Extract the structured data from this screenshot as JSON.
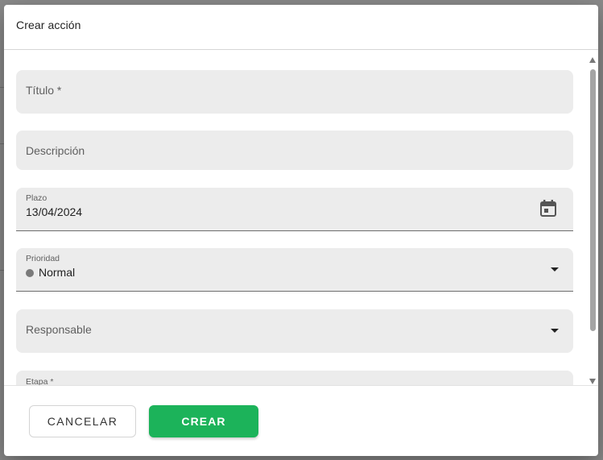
{
  "dialog": {
    "title": "Crear acción",
    "fields": {
      "titulo": {
        "placeholder": "Título *"
      },
      "descripcion": {
        "placeholder": "Descripción"
      },
      "plazo": {
        "label": "Plazo",
        "value": "13/04/2024",
        "icon": "calendar-icon"
      },
      "prioridad": {
        "label": "Prioridad",
        "value": "Normal",
        "dot_color": "#7a7a7a",
        "icon": "dropdown-arrow-icon"
      },
      "responsable": {
        "placeholder": "Responsable",
        "icon": "dropdown-arrow-icon"
      },
      "etapa": {
        "label": "Etapa *"
      }
    },
    "buttons": {
      "cancel": "CANCELAR",
      "create": "CREAR"
    }
  },
  "colors": {
    "accent": "#1cb35a",
    "field_bg": "#ececec"
  }
}
